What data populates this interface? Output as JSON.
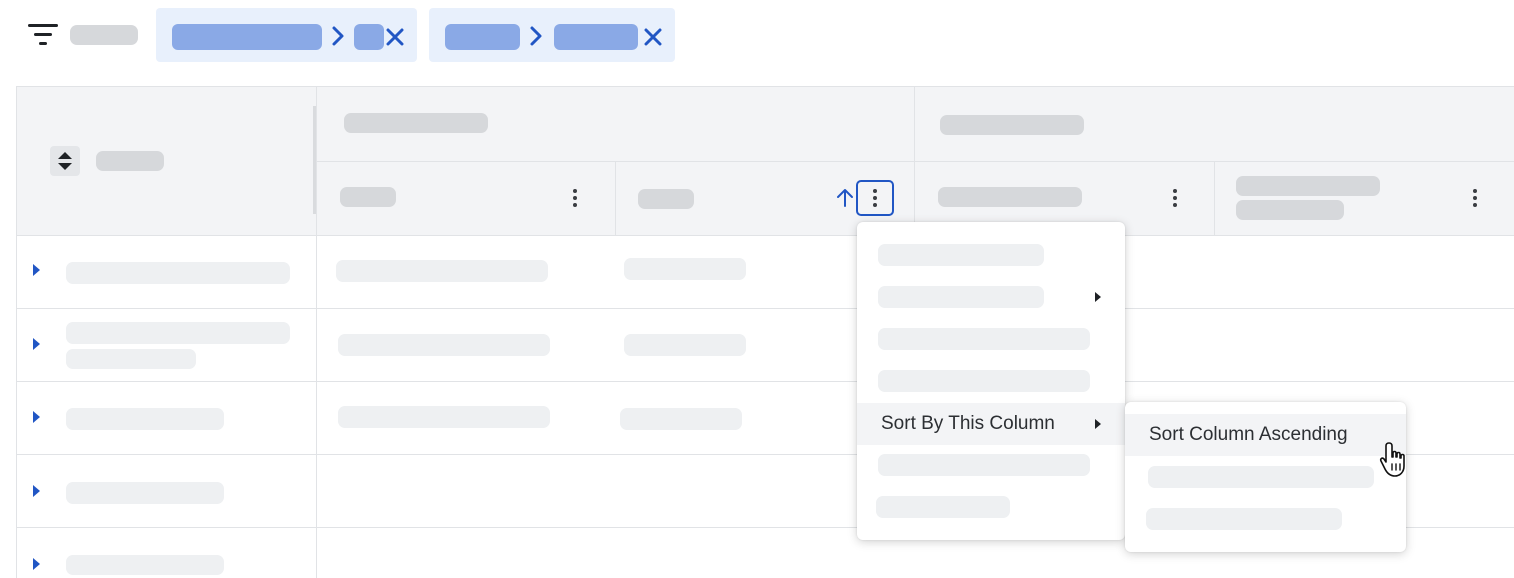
{
  "toolbar": {
    "filter_icon": "filter-icon",
    "chips": [
      {
        "remove_icon": "close-icon",
        "separator_icon": "chevron-right-icon"
      },
      {
        "remove_icon": "close-icon",
        "separator_icon": "chevron-right-icon"
      }
    ]
  },
  "grid": {
    "sorted_column_indicator_icon": "arrow-up-icon",
    "row_expand_icon": "caret-right-icon",
    "column_menu_icon": "more-vertical-icon"
  },
  "column_menu": {
    "items": [
      {
        "label": ""
      },
      {
        "label": "",
        "has_submenu": true
      },
      {
        "label": ""
      },
      {
        "label": ""
      },
      {
        "label": "Sort By This Column",
        "has_submenu": true,
        "highlighted": true
      },
      {
        "label": ""
      },
      {
        "label": ""
      }
    ]
  },
  "sort_submenu": {
    "items": [
      {
        "label": "Sort Column Ascending",
        "highlighted": true
      },
      {
        "label": ""
      },
      {
        "label": ""
      }
    ]
  },
  "colors": {
    "accent": "#2156c4",
    "chip_bg": "#e8f0fc",
    "header_bg": "#f3f4f6"
  }
}
